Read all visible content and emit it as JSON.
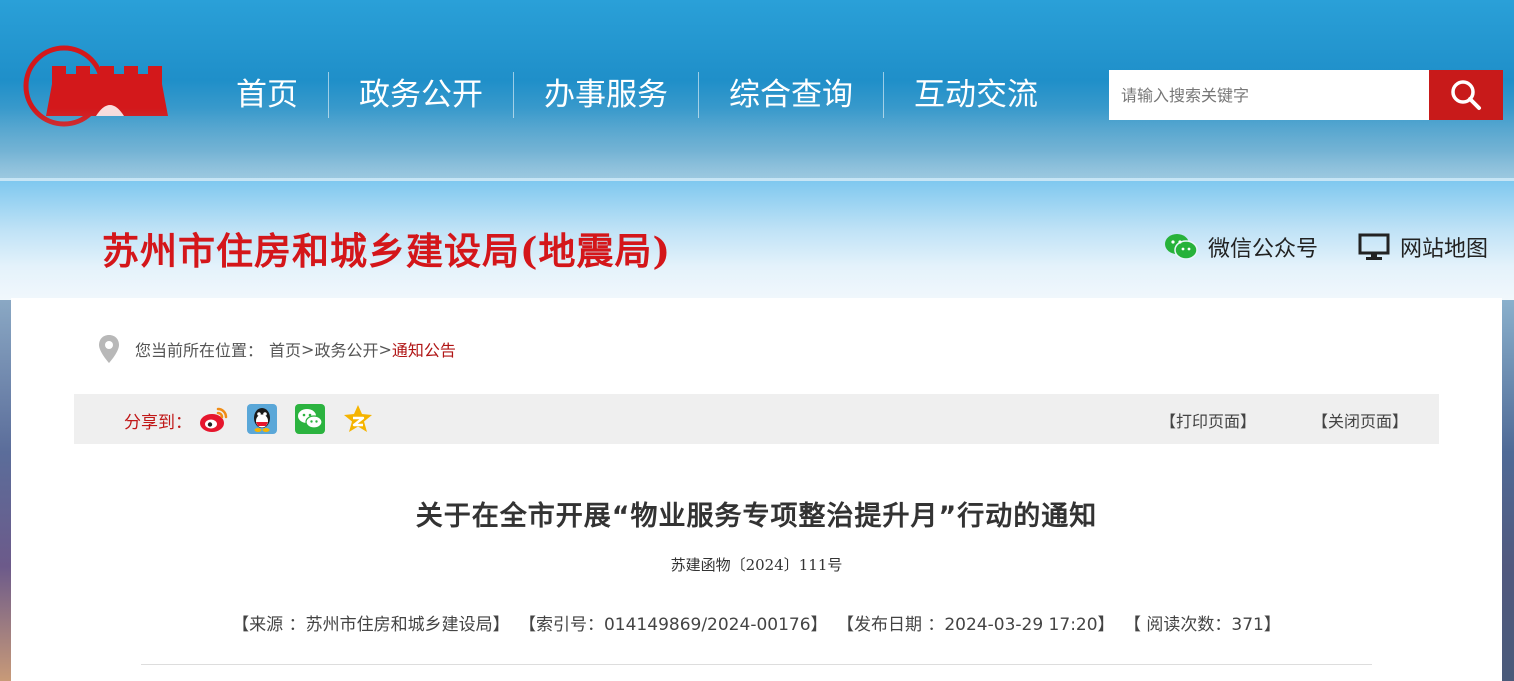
{
  "header": {
    "nav": [
      "首页",
      "政务公开",
      "办事服务",
      "综合查询",
      "互动交流"
    ],
    "search": {
      "placeholder": "请输入搜索关键字",
      "button_icon": "search-icon"
    },
    "logo_icon": "city-wall-logo"
  },
  "banner": {
    "site_title": "苏州市住房和城乡建设局(地震局)",
    "wechat": {
      "label": "微信公众号",
      "icon": "wechat-icon"
    },
    "sitemap": {
      "label": "网站地图",
      "icon": "monitor-icon"
    }
  },
  "breadcrumb": {
    "prefix": "您当前所在位置：",
    "items": [
      "首页",
      "政务公开",
      "通知公告"
    ],
    "separator": ">"
  },
  "share": {
    "label": "分享到：",
    "icons": [
      "weibo-icon",
      "qq-icon",
      "wechat-icon",
      "qzone-icon"
    ],
    "print_label": "【打印页面】",
    "close_label": "【关闭页面】"
  },
  "article": {
    "title": "关于在全市开展“物业服务专项整治提升月”行动的通知",
    "doc_number": "苏建函物〔2024〕111号",
    "meta": {
      "source": "【来源 ：苏州市住房和城乡建设局】",
      "index": "【索引号：014149869/2024-00176】",
      "date": "【发布日期 ：2024-03-29 17:20】",
      "views": "【 阅读次数：371】"
    }
  },
  "colors": {
    "accent_red": "#c81a1a",
    "title_red": "#d4161a",
    "header_blue": "#1f8fc9",
    "breadcrumb_current": "#b01515"
  }
}
